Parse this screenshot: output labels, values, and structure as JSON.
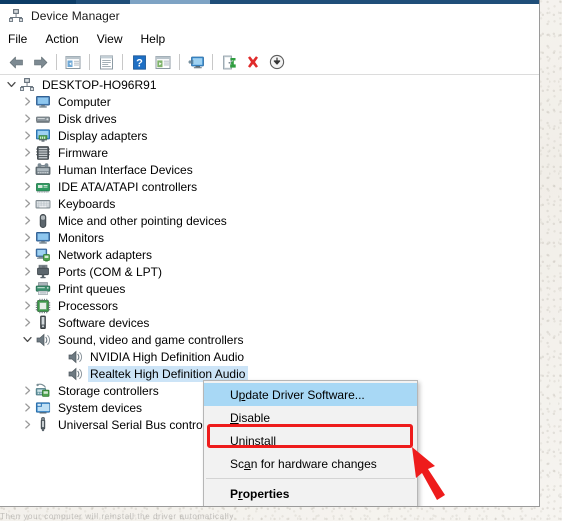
{
  "window": {
    "title": "Device Manager",
    "app_icon": "device-manager-icon"
  },
  "menubar": {
    "items": [
      {
        "label": "File",
        "name": "menu-file"
      },
      {
        "label": "Action",
        "name": "menu-action"
      },
      {
        "label": "View",
        "name": "menu-view"
      },
      {
        "label": "Help",
        "name": "menu-help"
      }
    ]
  },
  "toolbar": {
    "buttons": [
      {
        "name": "back-button",
        "icon": "left-arrow-icon",
        "title": "Back"
      },
      {
        "name": "forward-button",
        "icon": "right-arrow-icon",
        "title": "Forward"
      },
      {
        "name": "show-hide-console-tree-button",
        "icon": "console-tree-icon",
        "title": "Show/Hide Console Tree"
      },
      {
        "name": "properties-button",
        "icon": "properties-page-icon",
        "title": "Properties"
      },
      {
        "name": "help-button",
        "icon": "question-mark-icon",
        "title": "Help"
      },
      {
        "name": "view-button",
        "icon": "view-pane-icon",
        "title": "View"
      },
      {
        "name": "scan-hardware-changes-button",
        "icon": "monitor-scan-icon",
        "title": "Scan for hardware changes"
      },
      {
        "name": "update-driver-button",
        "icon": "green-door-update-icon",
        "title": "Update Driver Software"
      },
      {
        "name": "uninstall-button",
        "icon": "red-x-icon",
        "title": "Uninstall"
      },
      {
        "name": "disable-button",
        "icon": "down-arrow-circle-icon",
        "title": "Disable"
      }
    ]
  },
  "tree": {
    "nodes": [
      {
        "label": "DESKTOP-HO96R91",
        "level": 0,
        "state": "expanded",
        "icon": "computer-node-icon",
        "selected": false
      },
      {
        "label": "Computer",
        "level": 1,
        "state": "collapsed",
        "icon": "computer-icon",
        "selected": false
      },
      {
        "label": "Disk drives",
        "level": 1,
        "state": "collapsed",
        "icon": "disk-drive-icon",
        "selected": false
      },
      {
        "label": "Display adapters",
        "level": 1,
        "state": "collapsed",
        "icon": "display-adapter-icon",
        "selected": false
      },
      {
        "label": "Firmware",
        "level": 1,
        "state": "collapsed",
        "icon": "firmware-icon",
        "selected": false
      },
      {
        "label": "Human Interface Devices",
        "level": 1,
        "state": "collapsed",
        "icon": "hid-icon",
        "selected": false
      },
      {
        "label": "IDE ATA/ATAPI controllers",
        "level": 1,
        "state": "collapsed",
        "icon": "ide-controller-icon",
        "selected": false
      },
      {
        "label": "Keyboards",
        "level": 1,
        "state": "collapsed",
        "icon": "keyboard-icon",
        "selected": false
      },
      {
        "label": "Mice and other pointing devices",
        "level": 1,
        "state": "collapsed",
        "icon": "mouse-icon",
        "selected": false
      },
      {
        "label": "Monitors",
        "level": 1,
        "state": "collapsed",
        "icon": "monitor-icon",
        "selected": false
      },
      {
        "label": "Network adapters",
        "level": 1,
        "state": "collapsed",
        "icon": "network-adapter-icon",
        "selected": false
      },
      {
        "label": "Ports (COM & LPT)",
        "level": 1,
        "state": "collapsed",
        "icon": "port-icon",
        "selected": false
      },
      {
        "label": "Print queues",
        "level": 1,
        "state": "collapsed",
        "icon": "printer-icon",
        "selected": false
      },
      {
        "label": "Processors",
        "level": 1,
        "state": "collapsed",
        "icon": "processor-icon",
        "selected": false
      },
      {
        "label": "Software devices",
        "level": 1,
        "state": "collapsed",
        "icon": "software-device-icon",
        "selected": false
      },
      {
        "label": "Sound, video and game controllers",
        "level": 1,
        "state": "expanded",
        "icon": "speaker-icon",
        "selected": false
      },
      {
        "label": "NVIDIA High Definition Audio",
        "level": 2,
        "state": "leaf",
        "icon": "speaker-icon",
        "selected": false
      },
      {
        "label": "Realtek High Definition Audio",
        "level": 2,
        "state": "leaf",
        "icon": "speaker-icon",
        "selected": true
      },
      {
        "label": "Storage controllers",
        "level": 1,
        "state": "collapsed",
        "icon": "storage-controller-icon",
        "selected": false
      },
      {
        "label": "System devices",
        "level": 1,
        "state": "collapsed",
        "icon": "system-device-icon",
        "selected": false
      },
      {
        "label": "Universal Serial Bus controllers",
        "level": 1,
        "state": "collapsed",
        "icon": "usb-icon",
        "selected": false
      }
    ]
  },
  "context_menu": {
    "items": [
      {
        "label": "Update Driver Software...",
        "accel": "p",
        "highlighted": true,
        "bold": false,
        "name": "ctx-update-driver-software"
      },
      {
        "label": "Disable",
        "accel": "D",
        "highlighted": false,
        "bold": false,
        "name": "ctx-disable"
      },
      {
        "label": "Uninstall",
        "accel": "U",
        "highlighted": false,
        "bold": false,
        "name": "ctx-uninstall"
      },
      {
        "label": "Scan for hardware changes",
        "accel": "a",
        "highlighted": false,
        "bold": false,
        "name": "ctx-scan-for-hardware-changes"
      },
      {
        "label": "Properties",
        "accel": "r",
        "highlighted": false,
        "bold": true,
        "name": "ctx-properties"
      }
    ]
  },
  "annotations": {
    "highlight_color": "#EE1C1C",
    "highlight_target": "Uninstall",
    "arrow": "red-arrow-pointing-to-uninstall"
  },
  "colors": {
    "selection": "#CCE4F7",
    "menu_highlight": "#A8D8F5",
    "titlebar": "#1F4E79",
    "accent_red": "#EE1C1C"
  },
  "footer_text": "Then your computer will reinstall the driver automatically"
}
